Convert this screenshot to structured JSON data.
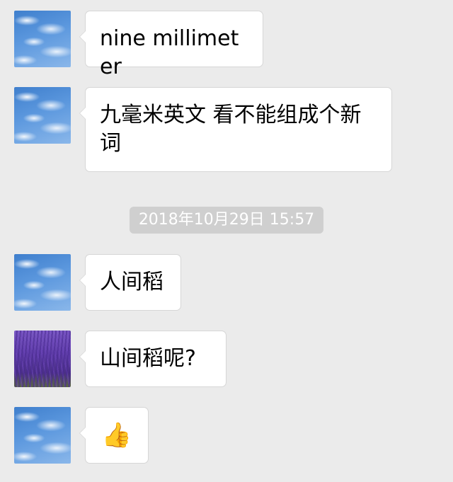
{
  "messages": [
    {
      "text": "nine millimeter",
      "avatar": "sky"
    },
    {
      "text": "九毫米英文 看不能组成个新词",
      "avatar": "sky"
    },
    {
      "text": "人间稻",
      "avatar": "sky"
    },
    {
      "text": "山间稻呢?",
      "avatar": "lavender"
    },
    {
      "text": "👍",
      "avatar": "sky"
    }
  ],
  "timestamp": "2018年10月29日 15:57",
  "colors": {
    "background": "#ebebeb",
    "bubble": "#ffffff",
    "bubble_border": "#d6d6d6",
    "timestamp_pill": "#cfcfcf"
  },
  "icons": {
    "reaction": "thumbs-up-icon"
  }
}
